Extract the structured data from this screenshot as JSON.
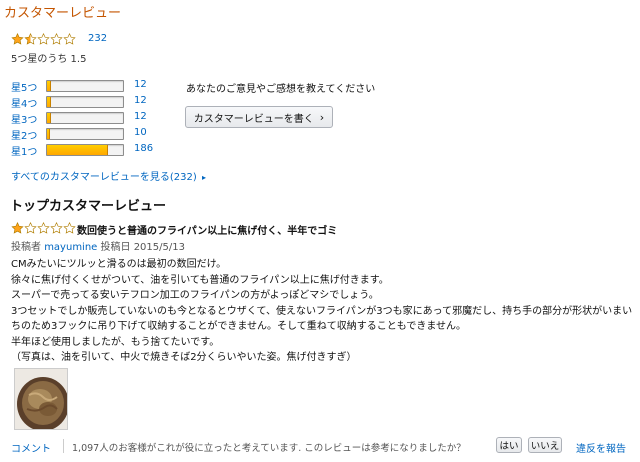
{
  "header": {
    "title": "カスタマーレビュー"
  },
  "summary": {
    "rating_value": 1.5,
    "rating_max": 5,
    "review_count": "232",
    "rating_text": "5つ星のうち 1.5",
    "star_color": "#ffa41c"
  },
  "histogram": [
    {
      "label": "星5つ",
      "count": "12",
      "fraction": 0.052
    },
    {
      "label": "星4つ",
      "count": "12",
      "fraction": 0.052
    },
    {
      "label": "星3つ",
      "count": "12",
      "fraction": 0.052
    },
    {
      "label": "星2つ",
      "count": "10",
      "fraction": 0.043
    },
    {
      "label": "星1つ",
      "count": "186",
      "fraction": 0.8
    }
  ],
  "cta": {
    "prompt": "あなたのご意見やご感想を教えてください",
    "button_label": "カスタマーレビューを書く",
    "button_chevron": "›"
  },
  "see_all": {
    "label": "すべてのカスタマーレビューを見る(232)",
    "chevron": "▸"
  },
  "top_reviews": {
    "heading": "トップカスタマーレビュー",
    "review": {
      "stars": 1,
      "title": "数回使うと普通のフライパン以上に焦げ付く、半年でゴミ",
      "author_prefix": "投稿者",
      "author": "mayumine",
      "date_text": "投稿日 2015/5/13",
      "body": [
        "CMみたいにツルッと滑るのは最初の数回だけ。",
        "徐々に焦げ付くくせがついて、油を引いても普通のフライパン以上に焦げ付きます。",
        "スーパーで売ってる安いテフロン加工のフライパンの方がよっぽどマシでしょう。",
        "3つセットでしか販売していないのも今となるとウザくて、使えないフライパンが3つも家にあって邪魔だし、持ち手の部分が形状がいまい",
        "ちのため3フックに吊り下げて収納することができません。そして重ねて収納することもできません。",
        "半年ほど使用しましたが、もう捨てたいです。",
        "（写真は、油を引いて、中火で焼きそば2分くらいやいた姿。焦げ付きすぎ）"
      ],
      "comment_label": "コメント",
      "helpful_text": "1,097人のお客様がこれが役に立ったと考えています. このレビューは参考になりましたか？",
      "yes_label": "はい",
      "no_label": "いいえ",
      "report_label": "違反を報告"
    }
  }
}
